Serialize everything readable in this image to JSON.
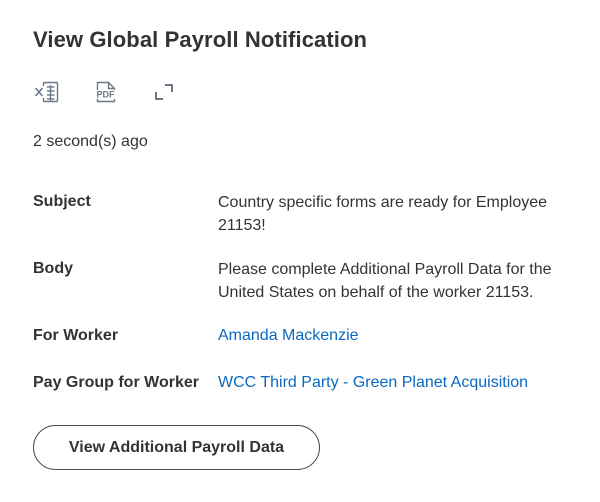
{
  "page": {
    "title": "View Global Payroll Notification",
    "timestamp": "2 second(s) ago"
  },
  "toolbar": {
    "excel_icon": "excel-export-icon",
    "pdf_icon": "pdf-export-icon",
    "pdf_text": "PDF",
    "expand_icon": "expand-icon"
  },
  "fields": {
    "subject": {
      "label": "Subject",
      "value_line1": "Country specific forms are ready for Employee",
      "value_line2": "21153!"
    },
    "body": {
      "label": "Body",
      "value_line1": "Please complete Additional Payroll Data for the",
      "value_line2": "United States on behalf of the worker 21153."
    },
    "for_worker": {
      "label": "For Worker",
      "value": "Amanda Mackenzie"
    },
    "pay_group": {
      "label": "Pay Group for Worker",
      "value": "WCC Third Party - Green Planet Acquisition"
    }
  },
  "actions": {
    "primary_label": "View Additional Payroll Data"
  },
  "colors": {
    "link": "#0b68c1",
    "text": "#333333",
    "icon": "#6b7784"
  }
}
